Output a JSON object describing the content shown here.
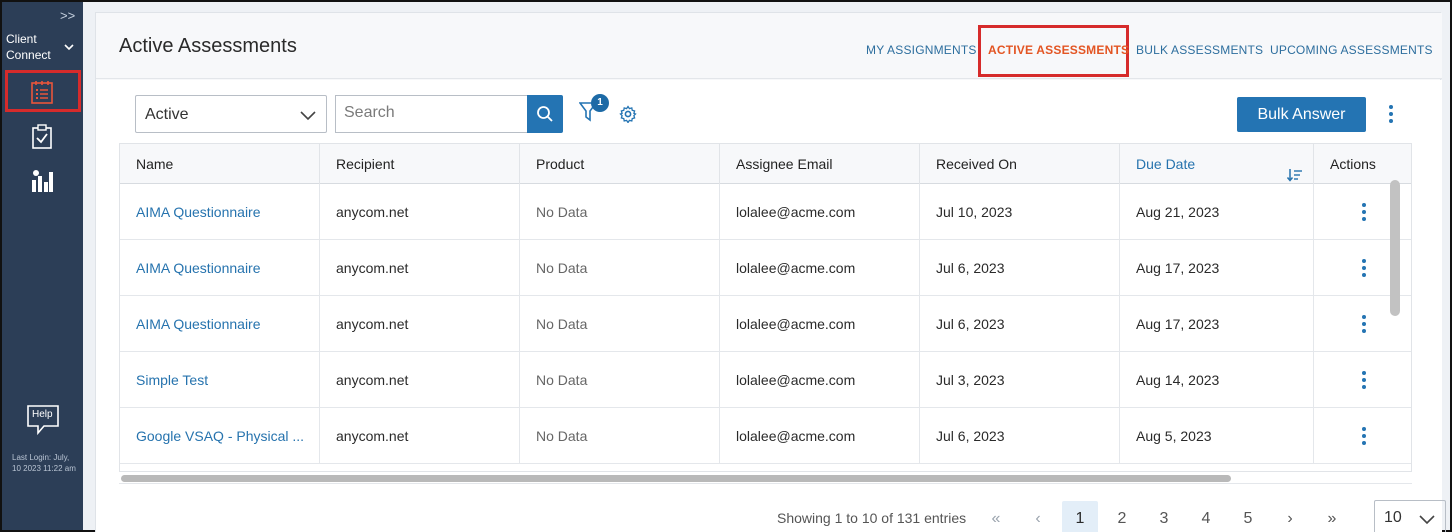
{
  "sidebar": {
    "expand_label": ">>",
    "client_name": "Client Connect",
    "help_label": "Help",
    "last_login": "Last Login: July, 10 2023 11:22 am",
    "icons": [
      "assessment-list-icon",
      "clipboard-check-icon",
      "reports-chart-icon"
    ]
  },
  "header": {
    "title": "Active Assessments",
    "tabs": [
      {
        "label": "MY ASSIGNMENTS"
      },
      {
        "label": "ACTIVE ASSESSMENTS"
      },
      {
        "label": "BULK ASSESSMENTS"
      },
      {
        "label": "UPCOMING ASSESSMENTS"
      }
    ]
  },
  "toolbar": {
    "status_value": "Active",
    "search_placeholder": "Search",
    "filter_count": "1",
    "bulk_answer_label": "Bulk Answer"
  },
  "table": {
    "columns": [
      "Name",
      "Recipient",
      "Product",
      "Assignee Email",
      "Received On",
      "Due Date",
      "Actions"
    ],
    "rows": [
      {
        "name": "AIMA Questionnaire",
        "recipient": "anycom.net",
        "product": "No Data",
        "email": "lolalee@acme.com",
        "received": "Jul 10, 2023",
        "due": "Aug 21, 2023"
      },
      {
        "name": "AIMA Questionnaire",
        "recipient": "anycom.net",
        "product": "No Data",
        "email": "lolalee@acme.com",
        "received": "Jul 6, 2023",
        "due": "Aug 17, 2023"
      },
      {
        "name": "AIMA Questionnaire",
        "recipient": "anycom.net",
        "product": "No Data",
        "email": "lolalee@acme.com",
        "received": "Jul 6, 2023",
        "due": "Aug 17, 2023"
      },
      {
        "name": "Simple Test",
        "recipient": "anycom.net",
        "product": "No Data",
        "email": "lolalee@acme.com",
        "received": "Jul 3, 2023",
        "due": "Aug 14, 2023"
      },
      {
        "name": "Google VSAQ - Physical ...",
        "recipient": "anycom.net",
        "product": "No Data",
        "email": "lolalee@acme.com",
        "received": "Jul 6, 2023",
        "due": "Aug 5, 2023"
      }
    ]
  },
  "pagination": {
    "summary": "Showing 1 to 10 of 131 entries",
    "first": "«",
    "prev": "‹",
    "pages": [
      "1",
      "2",
      "3",
      "4",
      "5"
    ],
    "next": "›",
    "last": "»",
    "per_page": "10"
  },
  "colors": {
    "sidebar": "#2c3e57",
    "accent": "#2474b3",
    "link": "#2673ae",
    "active_tab": "#e35523",
    "highlight_box": "#d62b2b"
  }
}
